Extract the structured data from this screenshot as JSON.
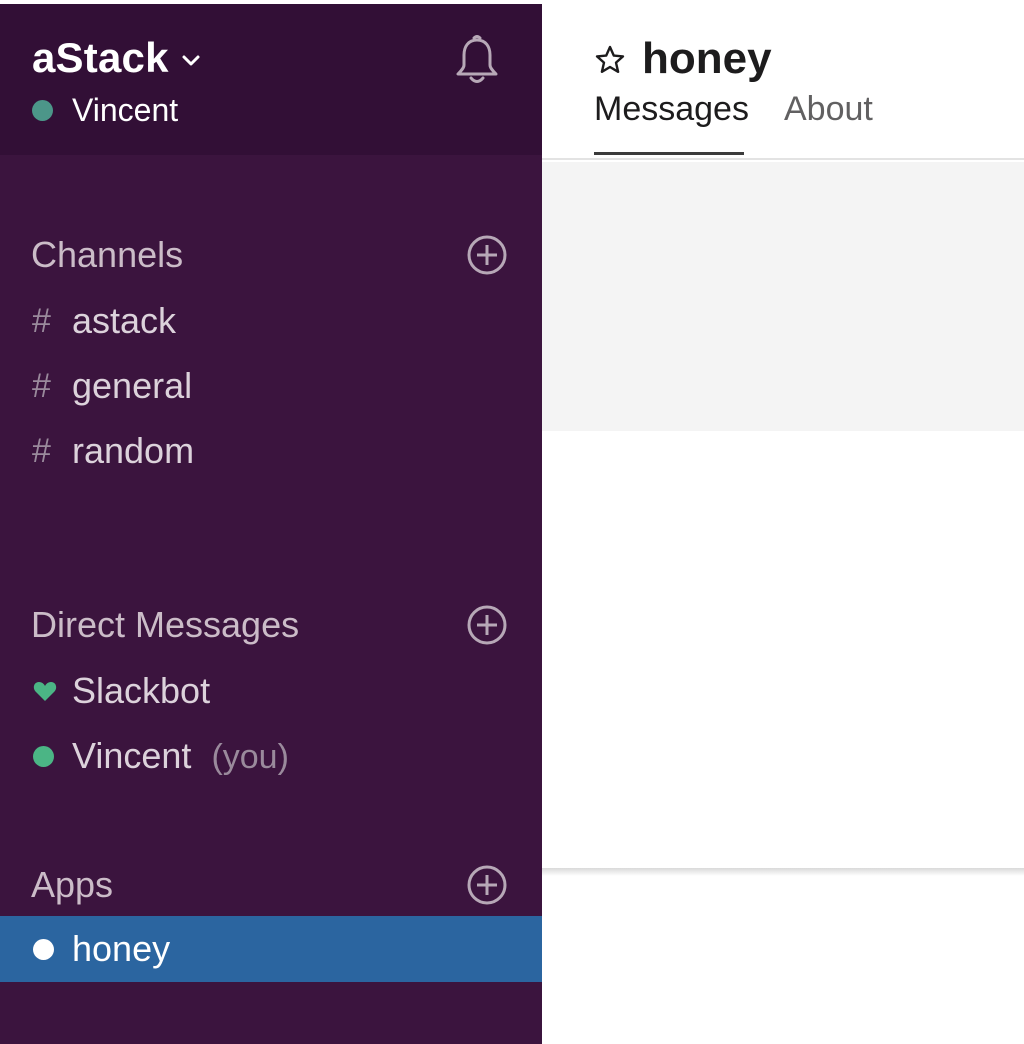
{
  "workspace": {
    "name": "aStack",
    "user": "Vincent",
    "presence_color": "#4c9689"
  },
  "sidebar": {
    "channels": {
      "title": "Channels",
      "items": [
        {
          "prefix": "#",
          "label": "astack"
        },
        {
          "prefix": "#",
          "label": "general"
        },
        {
          "prefix": "#",
          "label": "random"
        }
      ]
    },
    "direct_messages": {
      "title": "Direct Messages",
      "items": [
        {
          "label": "Slackbot",
          "icon": "heart-icon",
          "color": "#4bb585"
        },
        {
          "label": "Vincent",
          "suffix": "(you)",
          "icon": "presence-dot-icon",
          "color": "#4bb585"
        }
      ]
    },
    "apps": {
      "title": "Apps",
      "items": [
        {
          "label": "honey",
          "icon": "presence-dot-icon",
          "color": "#ffffff",
          "active": true
        }
      ]
    }
  },
  "channel": {
    "name": "honey",
    "tabs": [
      {
        "label": "Messages",
        "active": true
      },
      {
        "label": "About",
        "active": false
      }
    ]
  },
  "colors": {
    "sidebar_bg": "#3b143e",
    "sidebar_header_bg": "#320f36",
    "active_item_bg": "#2b65a0"
  }
}
